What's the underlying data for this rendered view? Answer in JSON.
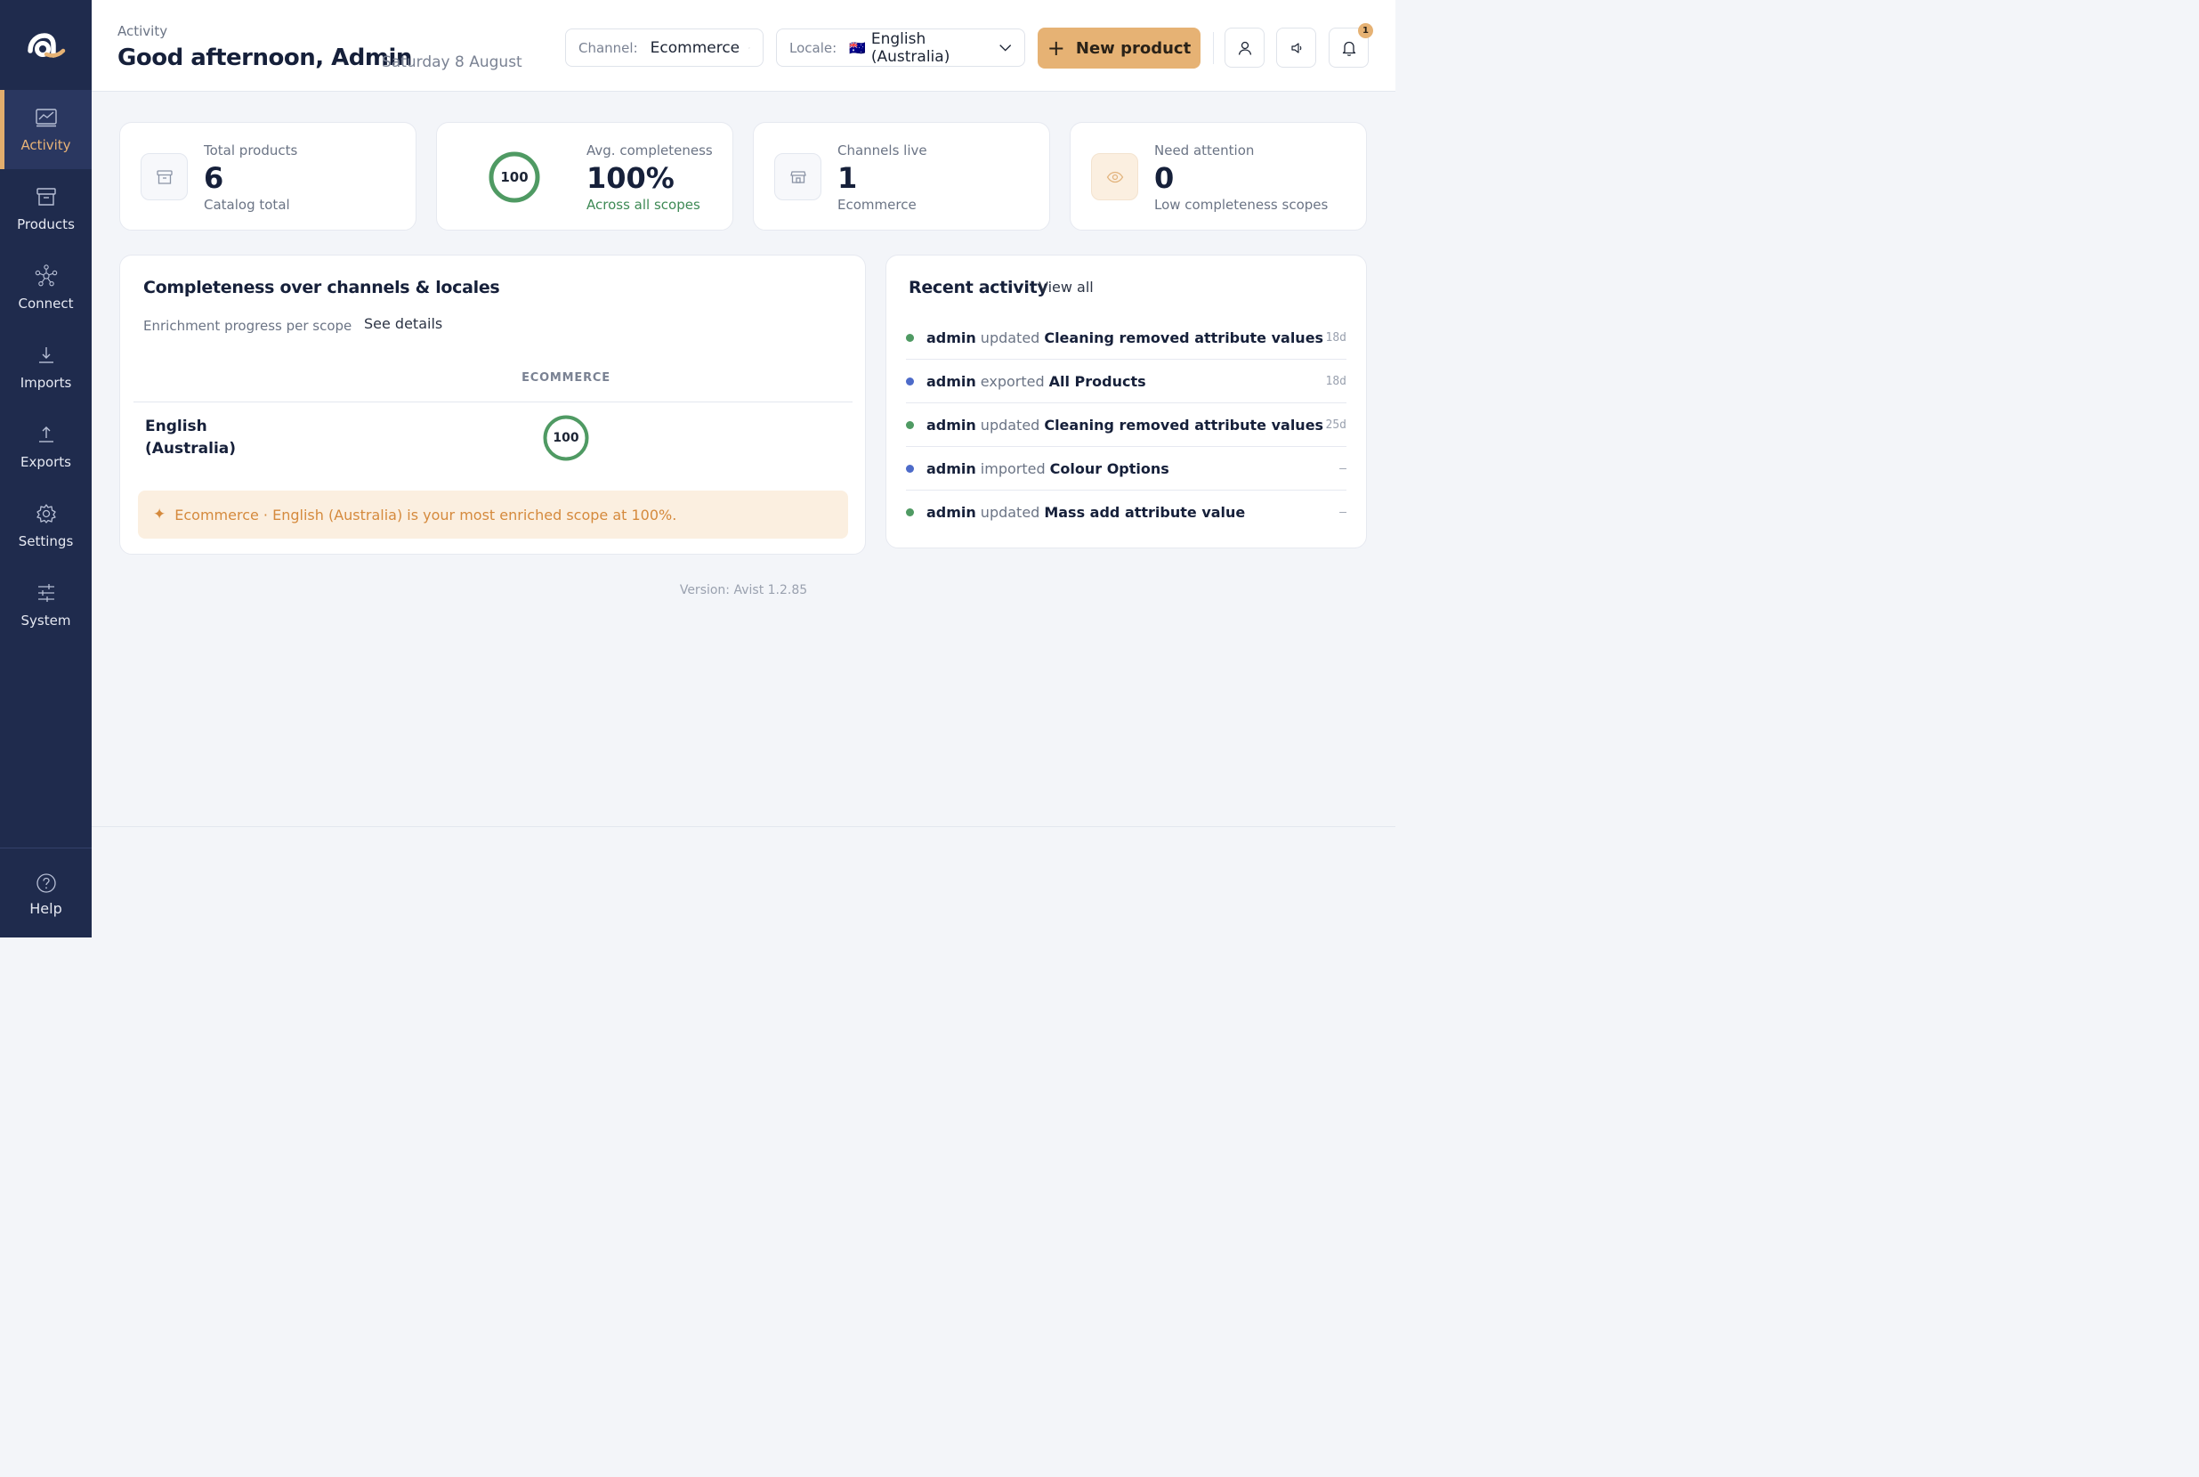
{
  "sidebar": {
    "items": [
      {
        "label": "Activity",
        "icon": "chart-icon"
      },
      {
        "label": "Products",
        "icon": "archive-icon"
      },
      {
        "label": "Connect",
        "icon": "network-icon"
      },
      {
        "label": "Imports",
        "icon": "import-icon"
      },
      {
        "label": "Exports",
        "icon": "export-icon"
      },
      {
        "label": "Settings",
        "icon": "gear-icon"
      },
      {
        "label": "System",
        "icon": "sliders-icon"
      }
    ],
    "help_label": "Help",
    "active": "Activity"
  },
  "header": {
    "breadcrumb": "Activity",
    "greeting": "Good afternoon, Admin",
    "date": "Saturday 8 August",
    "channel_label": "Channel:",
    "channel_value": "Ecommerce",
    "locale_label": "Locale:",
    "locale_flag": "🇦🇺",
    "locale_value": "English (Australia)",
    "new_product_label": "New product",
    "notification_count": "1"
  },
  "stats": {
    "total_products": {
      "label": "Total products",
      "value": "6",
      "sub": "Catalog total"
    },
    "avg_completeness": {
      "label": "Avg. completeness",
      "value": "100%",
      "sub": "Across all scopes",
      "ring": "100",
      "percent": 100
    },
    "channels_live": {
      "label": "Channels live",
      "value": "1",
      "sub": "Ecommerce"
    },
    "need_attention": {
      "label": "Need attention",
      "value": "0",
      "sub": "Low completeness scopes"
    }
  },
  "completeness": {
    "title": "Completeness over channels & locales",
    "subtitle": "Enrichment progress per scope",
    "see_details": "See details",
    "columns": [
      "ECOMMERCE"
    ],
    "rows": [
      {
        "locale": "English (Australia)",
        "values": [
          "100"
        ],
        "percent": 100
      }
    ],
    "insight": "Ecommerce · English (Australia) is your most enriched scope at 100%."
  },
  "activity": {
    "title": "Recent activity",
    "view_all": "View all",
    "items": [
      {
        "user": "admin",
        "verb": "updated",
        "object": "Cleaning removed attribute values",
        "time": "18d",
        "color": "#4f9a63"
      },
      {
        "user": "admin",
        "verb": "exported",
        "object": "All Products",
        "time": "18d",
        "color": "#4d6bc9"
      },
      {
        "user": "admin",
        "verb": "updated",
        "object": "Cleaning removed attribute values",
        "time": "25d",
        "color": "#4f9a63"
      },
      {
        "user": "admin",
        "verb": "imported",
        "object": "Colour Options",
        "time": "–",
        "color": "#4d6bc9"
      },
      {
        "user": "admin",
        "verb": "updated",
        "object": "Mass add attribute value",
        "time": "–",
        "color": "#4f9a63"
      }
    ]
  },
  "footer": {
    "version": "Version: Avist 1.2.85"
  },
  "colors": {
    "accent": "#e6b274",
    "sidebar": "#1f2b4d",
    "success": "#4f9a63",
    "info": "#4d6bc9"
  }
}
